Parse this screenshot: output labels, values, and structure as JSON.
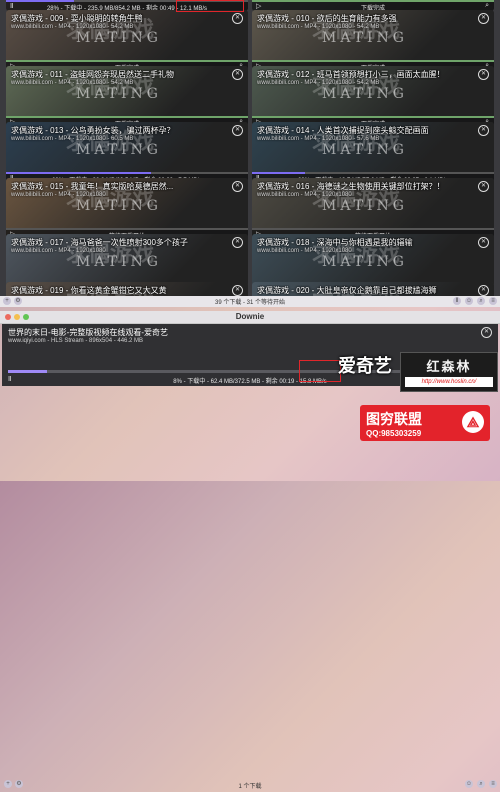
{
  "main_window": {
    "items": [
      {
        "title": "",
        "meta": "",
        "status": "28% - 下载中 - 235.9 MB/854.2 MB - 剩余 00:49 - 12.1 MB/s",
        "progress": 0.28,
        "bg": "#6d5c4a"
      },
      {
        "title": "",
        "meta": "",
        "status": "下载完成",
        "progress": 1,
        "bg": "#4b5b55"
      },
      {
        "title": "求偶游戏 - 009 - 耍小聪明的转角牛鸭",
        "meta": "www.bilibili.com - MP4 - 1920x1080 - 54.2 MB",
        "status": "下载完成",
        "progress": 1,
        "bg": "#5a4e45"
      },
      {
        "title": "求偶游戏 - 010 - 欲后的生育能力有多强",
        "meta": "www.bilibili.com - MP4 - 1920x1080 - 54.2 MB",
        "status": "下载完成",
        "progress": 1,
        "bg": "#5d574c"
      },
      {
        "title": "求偶游戏 - 011 - 盗蛙网怨奔现居然送二手礼物",
        "meta": "www.bilibili.com - MP4 - 1920x1080 - 54.2 MB",
        "status": "下载完成",
        "progress": 1,
        "bg": "#5e6a55"
      },
      {
        "title": "求偶游戏 - 012 - 班马首领预想打小三，画面太血腥！",
        "meta": "www.bilibili.com - MP4 - 1920x1080 - 54.2 MB",
        "status": "下载完成",
        "progress": 1,
        "bg": "#4e5a4f"
      },
      {
        "title": "求偶游戏 - 013 - 公鸟勇扮女装，骗过两杯孕？",
        "meta": "www.bilibili.com - MP4 - 1920x1080 - 60.5 MB",
        "status": "60% - 下载中 - 38.8 MB/60.5 MB - 剩余 00:02 - 7.7 MB/s",
        "progress": 0.6,
        "bg": "#2c3f50"
      },
      {
        "title": "求偶游戏 - 014 - 人类首次捕捉到座头鲸交配画面",
        "meta": "www.bilibili.com - MP4 - 1920x1080 - 57.6 MB",
        "status": "22% - 下载中 - 13.7 MB/57.6 MB - 剩余 00:07 - 6.1 MB/s",
        "progress": 0.22,
        "bg": "#2f4350"
      },
      {
        "title": "求偶游戏 - 015 - 我童年！真实版哈莫德居然...",
        "meta": "www.bilibili.com - MP4 - 1920x1080",
        "status": "等待下载开始",
        "progress": 0,
        "bg": "#6a5540"
      },
      {
        "title": "求偶游戏 - 016 - 海德谜之生物使用关键部位打架？！",
        "meta": "www.bilibili.com - MP4 - 1920x1080",
        "status": "等待下载开始",
        "progress": 0,
        "bg": "#4d4a42"
      },
      {
        "title": "求偶游戏 - 017 - 海马爸爸一次性喷射300多个孩子",
        "meta": "www.bilibili.com - MP4 - 1920x1080",
        "status": "等待下载开始",
        "progress": 0,
        "bg": "#4f5760"
      },
      {
        "title": "求偶游戏 - 018 - 深海中与你相遇是我的辐输",
        "meta": "www.bilibili.com - MP4 - 1920x1080",
        "status": "等待下载开始",
        "progress": 0,
        "bg": "#3d4d57"
      },
      {
        "title": "求偶游戏 - 019 - 你看这黄金蟹钳它又大又黄",
        "meta": "",
        "status": "",
        "progress": 0,
        "bg": "#5a5048"
      },
      {
        "title": "求偶游戏 - 020 - 大肚皇帝仅企鹅靠自己都拔尴海狮",
        "meta": "",
        "status": "",
        "progress": 0,
        "bg": "#485660"
      }
    ],
    "watermark_en": "MATING",
    "watermark_cn": "求偶游戏",
    "status_text": "39 个下载 - 31 个等待开始"
  },
  "downie_window": {
    "title": "Downie",
    "item": {
      "title": "世界的末日-电影-完整版视频在线观看-爱奇艺",
      "meta": "www.iqiyi.com - HLS Stream - 896x504 - 446.2 MB",
      "status": "8% - 下载中 - 62.4 MB/372.5 MB - 剩余 00:19 - 15.8 MB/s",
      "progress": 0.08
    },
    "status_text": "1 个下载"
  },
  "overlays": {
    "iqiyi_logo": "爱奇艺",
    "hslin_name": "红森林",
    "hslin_url": "http://www.hoslin.cn/",
    "tc_title": "图穷联盟",
    "tc_qq": "QQ:985303259",
    "tc_logo": "⟁"
  },
  "colors": {
    "progress": "#7d6cf2",
    "highlight": "#e0262b",
    "brand_red": "#e3232b"
  }
}
